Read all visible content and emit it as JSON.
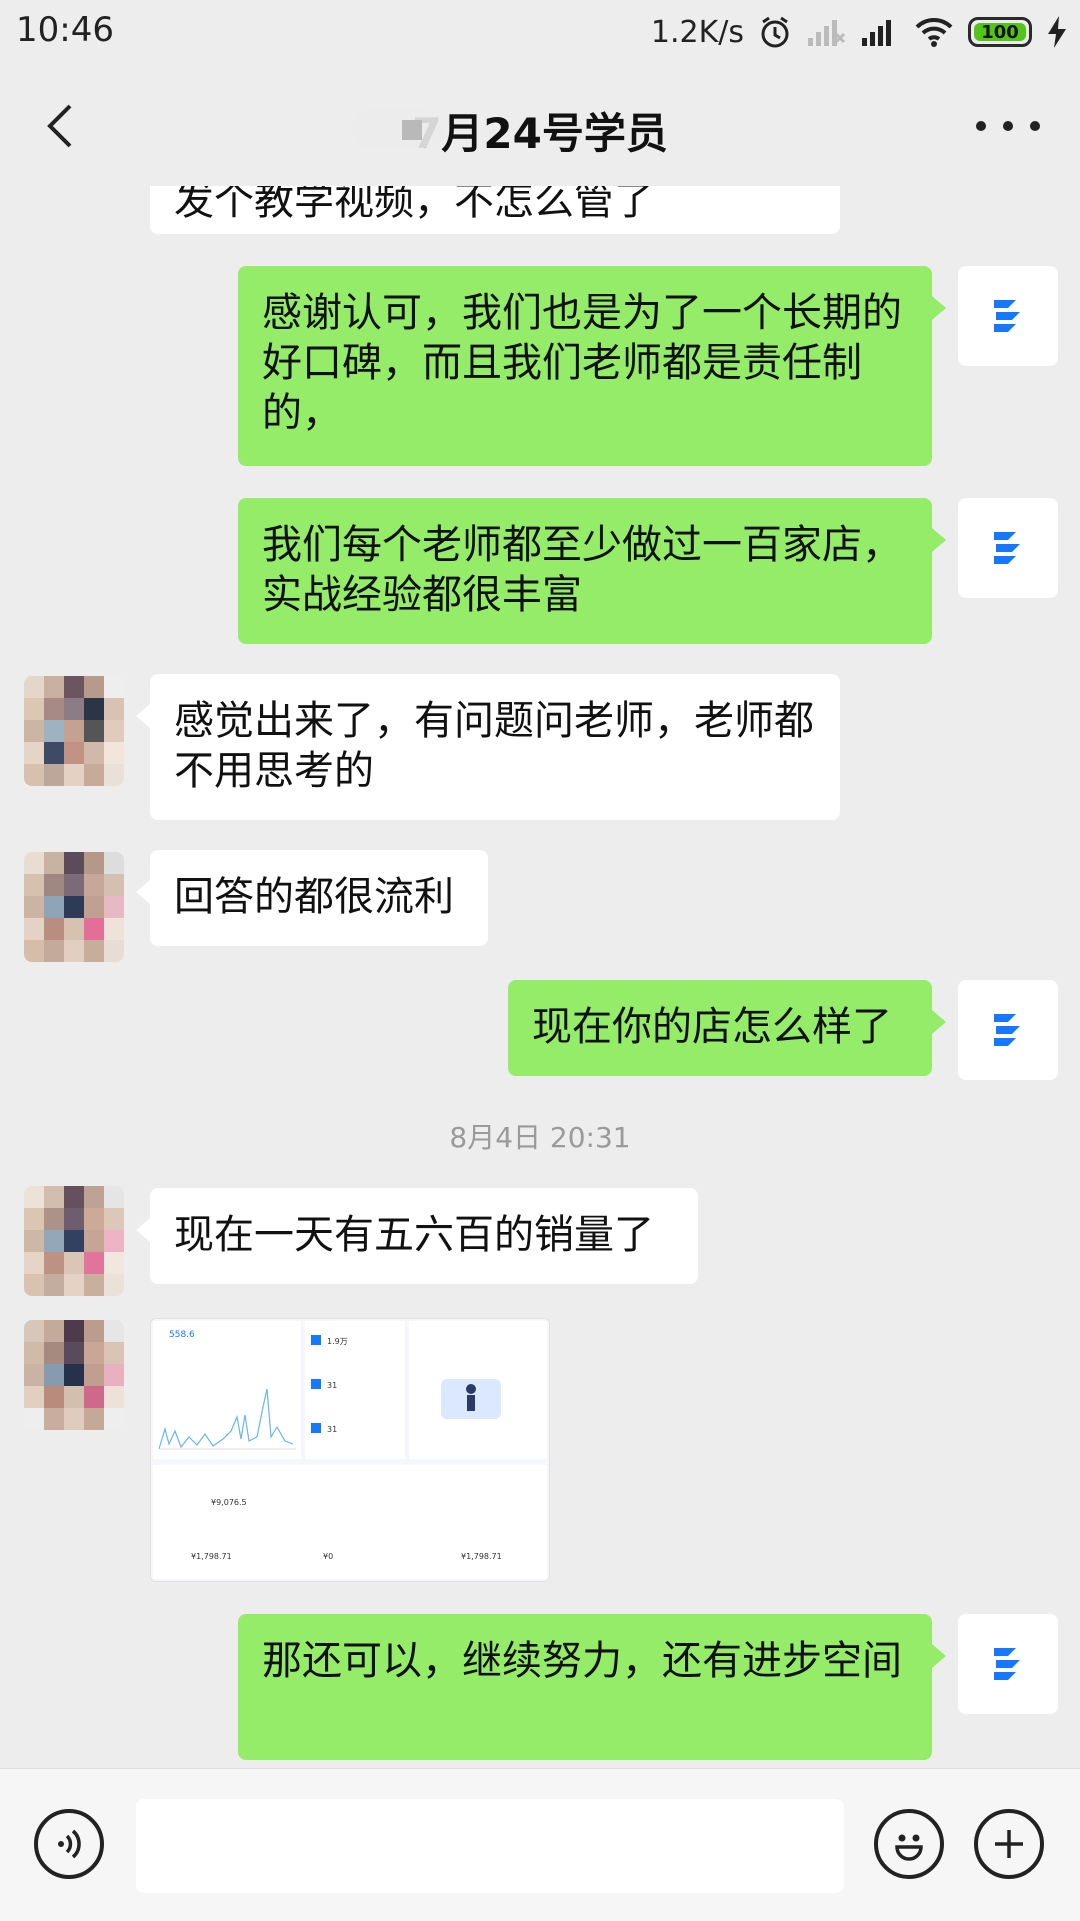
{
  "status_bar": {
    "time": "10:46",
    "net_speed": "1.2K/s",
    "battery": "100",
    "icons": [
      "alarm-icon",
      "signal-off-icon",
      "signal-icon",
      "wifi-icon",
      "battery-icon",
      "charging-icon"
    ]
  },
  "header": {
    "title": "7月24号学员",
    "back_icon": "chevron-left-icon",
    "more_icon": "more-dots-icon"
  },
  "messages": [
    {
      "side": "left",
      "text": "发个教学视频，不怎么管了",
      "partial": true
    },
    {
      "side": "right",
      "text": "感谢认可，我们也是为了一个长期的好口碑，而且我们老师都是责任制的，"
    },
    {
      "side": "right",
      "text": "我们每个老师都至少做过一百家店，实战经验都很丰富"
    },
    {
      "side": "left",
      "text": "感觉出来了，有问题问老师，老师都不用思考的"
    },
    {
      "side": "left",
      "text": "回答的都很流利"
    },
    {
      "side": "right",
      "text": "现在你的店怎么样了"
    },
    {
      "type": "timestamp",
      "text": "8月4日 20:31"
    },
    {
      "side": "left",
      "text": "现在一天有五六百的销量了"
    },
    {
      "side": "left",
      "type": "image",
      "text_stats": [
        "558.6",
        "1.9万",
        "31",
        "31",
        "¥9,076.5",
        "¥1,798.71",
        "¥0",
        "¥1,798.71"
      ]
    },
    {
      "side": "right",
      "text": "那还可以，继续努力，还有进步空间"
    }
  ],
  "colors": {
    "background": "#ededed",
    "self_bubble": "#95ec69",
    "peer_bubble": "#ffffff",
    "battery_green": "#52c41a"
  },
  "input_bar": {
    "voice_icon": "voice-icon",
    "emoji_icon": "emoji-icon",
    "plus_icon": "plus-icon",
    "value": ""
  }
}
